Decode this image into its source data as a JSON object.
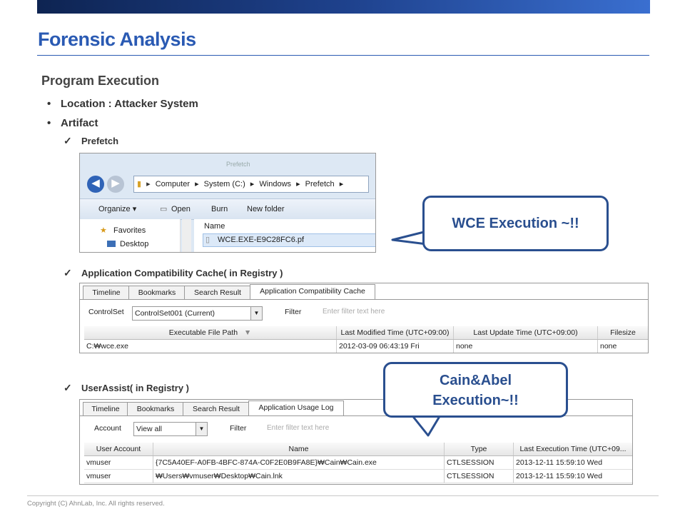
{
  "slide": {
    "title": "Forensic Analysis",
    "section": "Program Execution",
    "bullets": [
      "Location : Attacker System",
      "Artifact"
    ],
    "checks": [
      "Prefetch",
      "Application Compatibility Cache( in Registry )",
      "UserAssist( in Registry )"
    ],
    "copyright": "Copyright (C) AhnLab, Inc. All rights reserved.",
    "accent_color": "#2a5ab3"
  },
  "explorer": {
    "ghost_title": "Prefetch",
    "address": [
      "Computer",
      "System (C:)",
      "Windows",
      "Prefetch"
    ],
    "toolbar": {
      "organize": "Organize",
      "open": "Open",
      "burn": "Burn",
      "new_folder": "New folder"
    },
    "nav": {
      "favorites": "Favorites",
      "desktop": "Desktop"
    },
    "column": "Name",
    "file": "WCE.EXE-E9C28FC6.pf"
  },
  "appcompat": {
    "tabs": [
      "Timeline",
      "Bookmarks",
      "Search Result",
      "Application Compatibility Cache"
    ],
    "control_label": "ControlSet",
    "control_value": "ControlSet001 (Current)",
    "filter_label": "Filter",
    "filter_placeholder": "Enter filter text here",
    "headers": [
      "Executable File Path",
      "Last Modified Time (UTC+09:00)",
      "Last Update Time (UTC+09:00)",
      "Filesize"
    ],
    "rows": [
      [
        "C:₩wce.exe",
        "2012-03-09  06:43:19  Fri",
        "none",
        "none"
      ]
    ]
  },
  "userassist": {
    "tabs": [
      "Timeline",
      "Bookmarks",
      "Search Result",
      "Application Usage Log"
    ],
    "account_label": "Account",
    "account_value": "View all",
    "filter_label": "Filter",
    "filter_placeholder": "Enter filter text here",
    "headers": [
      "User Account",
      "Name",
      "Type",
      "Last Execution Time (UTC+09..."
    ],
    "rows": [
      [
        "vmuser",
        "{7C5A40EF-A0FB-4BFC-874A-C0F2E0B9FA8E}₩Cain₩Cain.exe",
        "CTLSESSION",
        "2013-12-11  15:59:10  Wed"
      ],
      [
        "vmuser",
        "₩Users₩vmuser₩Desktop₩Cain.lnk",
        "CTLSESSION",
        "2013-12-11  15:59:10  Wed"
      ]
    ]
  },
  "callouts": {
    "wce": "WCE Execution ~!!",
    "cain_line1": "Cain&Abel",
    "cain_line2": "Execution~!!",
    "border_color": "#2a4f8f"
  }
}
